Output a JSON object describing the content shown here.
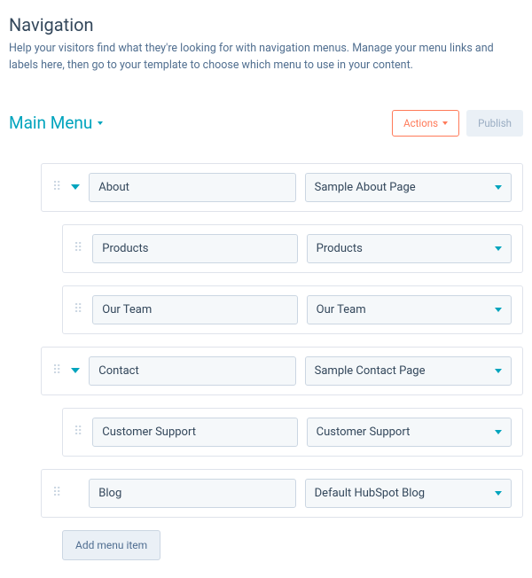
{
  "page": {
    "title": "Navigation",
    "description": "Help your visitors find what they're looking for with navigation menus. Manage your menu links and labels here, then go to your template to choose which menu to use in your content."
  },
  "header": {
    "menu_name": "Main Menu",
    "actions_label": "Actions",
    "publish_label": "Publish"
  },
  "items": [
    {
      "label": "About",
      "page": "Sample About Page",
      "level": 0,
      "expandable": true
    },
    {
      "label": "Products",
      "page": "Products",
      "level": 1,
      "expandable": false
    },
    {
      "label": "Our Team",
      "page": "Our Team",
      "level": 1,
      "expandable": false
    },
    {
      "label": "Contact",
      "page": "Sample Contact Page",
      "level": 0,
      "expandable": true
    },
    {
      "label": "Customer Support",
      "page": "Customer Support",
      "level": 1,
      "expandable": false
    },
    {
      "label": "Blog",
      "page": "Default HubSpot Blog",
      "level": 0,
      "expandable": false
    }
  ],
  "add_label": "Add menu item"
}
